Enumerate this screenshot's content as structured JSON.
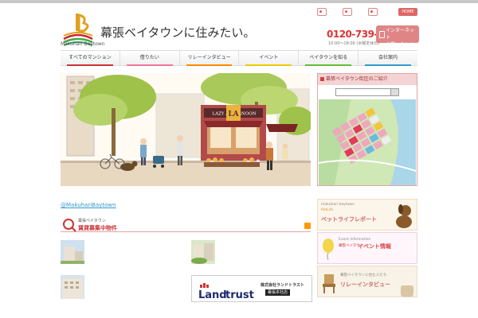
{
  "header": {
    "tagline": "",
    "logo_text": "Makuhari Baytown",
    "site_title": "幕張ベイタウンに住みたい。",
    "util_links": [
      "",
      "",
      ""
    ],
    "home_label": "HOME",
    "contact_label": "",
    "phone": "0120-739-081",
    "hours": "10:00〜18:00 (水曜定休日)",
    "net_button_line1": "インターネット",
    "net_button_line2": "お問い合わせ"
  },
  "nav": {
    "items": [
      "すべてのマンション",
      "借りたい",
      "リレーインタビュー",
      "イベント",
      "ベイタウンを知る",
      "会社案内"
    ]
  },
  "hero": {
    "shop_sign": "LAZY AFTERNOON",
    "sign_letters": "LA"
  },
  "side_map": {
    "heading": "幕張ベイタウン街区のご紹介",
    "select_value": ""
  },
  "twitter": {
    "label": "@MakuhariBaytown"
  },
  "rental": {
    "small_label": "幕張ベイタウン",
    "title": "賃貸募集中物件",
    "listings": [
      {
        "title": "",
        "desc": ""
      },
      {
        "title": "",
        "desc": ""
      },
      {
        "title": "",
        "desc": ""
      }
    ]
  },
  "landtrust": {
    "logo_text_a": "Land",
    "logo_text_b": "trust",
    "company": "株式会社ランドトラスト",
    "branch": "幕張本社店"
  },
  "banners": {
    "pet": {
      "small": "makuhari baytown",
      "sub": "PetLife",
      "main": "ペットライフレポート"
    },
    "event": {
      "small": "Event Information",
      "sub": "幕張ベイタウン",
      "main": "イベント情報"
    },
    "relay": {
      "small": "幕張ベイタウンに住む人たち",
      "main": "リレーインタビュー"
    },
    "more": {
      "main": ""
    }
  },
  "colors": {
    "brand_red": "#d33333",
    "accent_pink": "#e08585",
    "link_blue": "#3399cc"
  }
}
